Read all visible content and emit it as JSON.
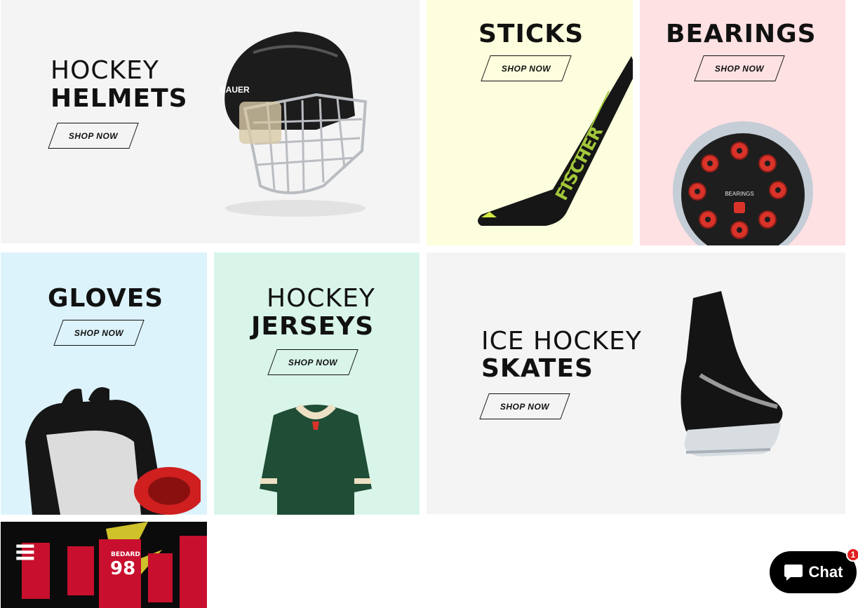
{
  "tiles": {
    "helmets": {
      "line1": "HOCKEY",
      "line2": "HELMETS",
      "cta": "SHOP NOW",
      "product_brand": "BAUER"
    },
    "sticks": {
      "title": "STICKS",
      "cta": "SHOP NOW",
      "product_brand": "FISCHER"
    },
    "bearings": {
      "title": "BEARINGS",
      "cta": "SHOP NOW",
      "product_label": "BEARINGS"
    },
    "gloves": {
      "title": "GLOVES",
      "cta": "SHOP NOW"
    },
    "jerseys": {
      "line1": "HOCKEY",
      "line2": "JERSEYS",
      "cta": "SHOP NOW"
    },
    "skates": {
      "line1": "ICE HOCKEY",
      "line2": "SKATES",
      "cta": "SHOP NOW"
    },
    "promo": {
      "player_name": "BEDARD",
      "player_number": "98"
    }
  },
  "chat": {
    "label": "Chat",
    "badge_count": "1"
  },
  "colors": {
    "helmets_bg": "#f4f4f4",
    "sticks_bg": "#fdfedd",
    "bearings_bg": "#fee1e3",
    "gloves_bg": "#dcf3fb",
    "jerseys_bg": "#d9f5ea",
    "skates_bg": "#f4f4f4",
    "jersey_green": "#1f4d35",
    "bearing_red": "#d9332a"
  }
}
